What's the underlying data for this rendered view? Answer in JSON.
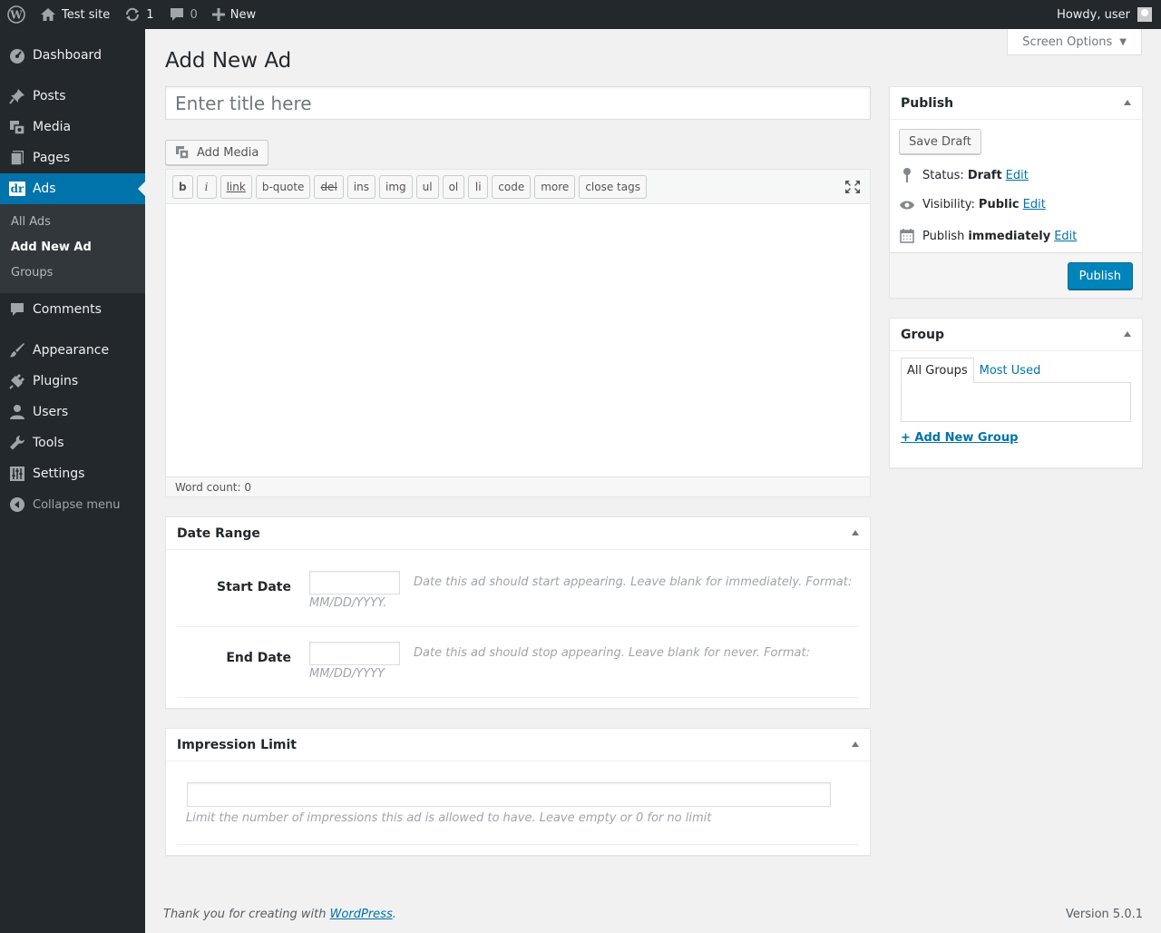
{
  "adminbar": {
    "site_name": "Test site",
    "updates_count": "1",
    "comments_count": "0",
    "new_label": "New",
    "howdy": "Howdy, user"
  },
  "menu": {
    "dashboard": "Dashboard",
    "posts": "Posts",
    "media": "Media",
    "pages": "Pages",
    "ads": "Ads",
    "ads_badge": "dr",
    "sub_all_ads": "All Ads",
    "sub_add_new": "Add New Ad",
    "sub_groups": "Groups",
    "comments": "Comments",
    "appearance": "Appearance",
    "plugins": "Plugins",
    "users": "Users",
    "tools": "Tools",
    "settings": "Settings",
    "collapse": "Collapse menu"
  },
  "page": {
    "screen_options": "Screen Options",
    "title": "Add New Ad",
    "title_placeholder": "Enter title here",
    "add_media": "Add Media"
  },
  "editor": {
    "buttons": [
      "b",
      "i",
      "link",
      "b-quote",
      "del",
      "ins",
      "img",
      "ul",
      "ol",
      "li",
      "code",
      "more",
      "close tags"
    ],
    "word_count": "Word count: 0"
  },
  "date_range": {
    "heading": "Date Range",
    "start_label": "Start Date",
    "start_desc": "Date this ad should start appearing. Leave blank for immediately. Format: MM/DD/YYYY.",
    "end_label": "End Date",
    "end_desc": "Date this ad should stop appearing. Leave blank for never. Format: MM/DD/YYYY"
  },
  "impression": {
    "heading": "Impression Limit",
    "desc": "Limit the number of impressions this ad is allowed to have. Leave empty or 0 for no limit"
  },
  "publish": {
    "heading": "Publish",
    "save_draft": "Save Draft",
    "status_label": "Status:",
    "status_value": "Draft",
    "visibility_label": "Visibility:",
    "visibility_value": "Public",
    "publish_label": "Publish",
    "publish_value": "immediately",
    "edit": "Edit",
    "publish_button": "Publish"
  },
  "group": {
    "heading": "Group",
    "tab_all": "All Groups",
    "tab_most_used": "Most Used",
    "add_new": "+ Add New Group"
  },
  "footer": {
    "thanks": "Thank you for creating with ",
    "wp_link": "WordPress",
    "thanks_end": ".",
    "version": "Version 5.0.1"
  },
  "colors": {
    "menu_bg": "#23282d",
    "accent": "#0073aa",
    "publish_button": "#0085ba"
  }
}
